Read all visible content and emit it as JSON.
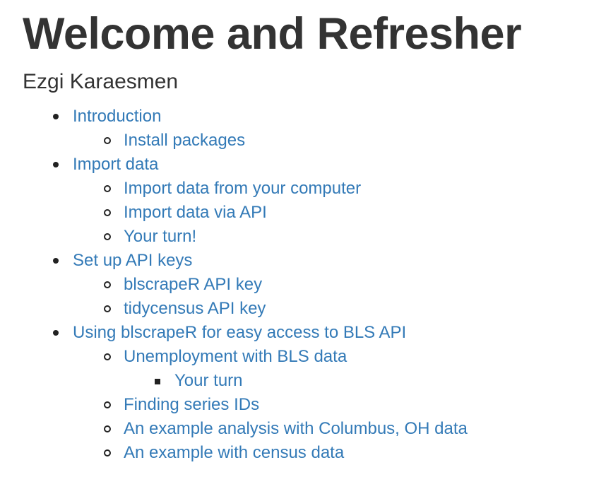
{
  "header": {
    "title": "Welcome and Refresher",
    "author": "Ezgi Karaesmen"
  },
  "toc": [
    {
      "label": "Introduction",
      "children": [
        {
          "label": "Install packages",
          "children": []
        }
      ]
    },
    {
      "label": "Import data",
      "children": [
        {
          "label": "Import data from your computer",
          "children": []
        },
        {
          "label": "Import data via API",
          "children": []
        },
        {
          "label": "Your turn!",
          "children": []
        }
      ]
    },
    {
      "label": "Set up API keys",
      "children": [
        {
          "label": "blscrapeR API key",
          "children": []
        },
        {
          "label": "tidycensus API key",
          "children": []
        }
      ]
    },
    {
      "label": "Using blscrapeR for easy access to BLS API",
      "children": [
        {
          "label": "Unemployment with BLS data",
          "children": [
            {
              "label": "Your turn",
              "children": []
            }
          ]
        },
        {
          "label": "Finding series IDs",
          "children": []
        },
        {
          "label": "An example analysis with Columbus, OH data",
          "children": []
        },
        {
          "label": "An example with census data",
          "children": []
        }
      ]
    }
  ]
}
